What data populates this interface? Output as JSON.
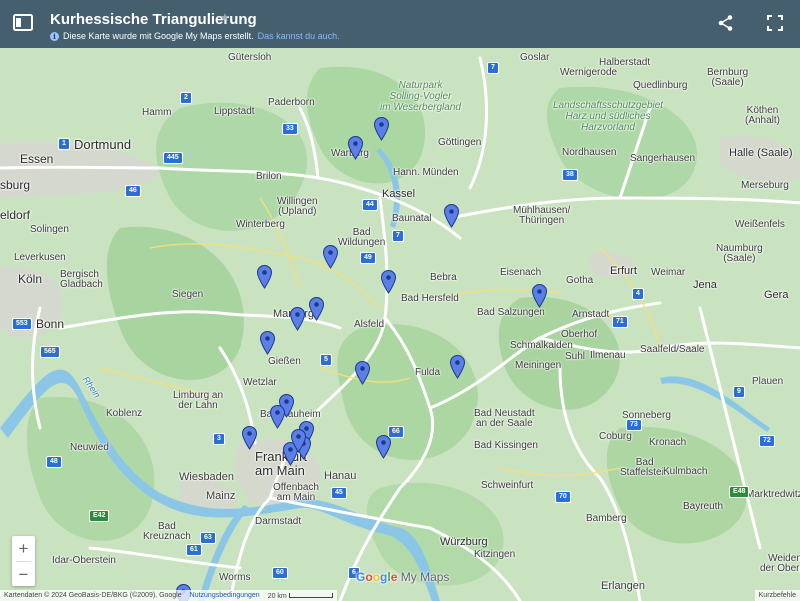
{
  "header": {
    "title": "Kurhessische Triangulierung",
    "subtitle": "Diese Karte wurde mit Google My Maps erstellt.",
    "subtitle_link": "Das kannst du auch.",
    "icons": [
      "sidebar-icon",
      "star-icon",
      "info-icon",
      "share-icon",
      "fullscreen-icon"
    ],
    "colors": {
      "header_bg": "#455f6f",
      "link": "#8ab8ff",
      "marker": "#5b7fe6",
      "map_land": "#c9e3c0"
    }
  },
  "map": {
    "labels": {
      "guetersloh": "Gütersloh",
      "hamm": "Hamm",
      "lippstadt": "Lippstadt",
      "paderborn": "Paderborn",
      "dortmund": "Dortmund",
      "essen": "Essen",
      "burg": "sburg",
      "eldorf": "eldorf",
      "leverkusen": "Leverkusen",
      "solingen": "Solingen",
      "koeln": "Köln",
      "bergisch": "Bergisch\nGladbach",
      "bonn": "Bonn",
      "brilon": "Brilon",
      "willingen": "Willingen\n(Upland)",
      "winterberg": "Winterberg",
      "siegen": "Siegen",
      "warburg": "Warburg",
      "kassel": "Kassel",
      "hann": "Hann. Münden",
      "baunatal": "Baunatal",
      "goettingen": "Göttingen",
      "bad_wildungen": "Bad\nWildungen",
      "marburg": "Marburg",
      "giessen": "Gießen",
      "wetzlar": "Wetzlar",
      "alsfeld": "Alsfeld",
      "bebra": "Bebra",
      "bad_hersfeld": "Bad Hersfeld",
      "fulda": "Fulda",
      "eisenach": "Eisenach",
      "gotha": "Gotha",
      "erfurt": "Erfurt",
      "weimar": "Weimar",
      "jena": "Jena",
      "gera": "Gera",
      "bad_salzungen": "Bad Salzungen",
      "arnstadt": "Arnstadt",
      "oberhof": "Oberhof",
      "schmalkalden": "Schmalkalden",
      "suhl": "Suhl",
      "ilmenau": "Ilmenau",
      "saalfeld": "Saalfeld/Saale",
      "meiningen": "Meiningen",
      "plauen": "Plauen",
      "muehlhausen": "Mühlhausen/\nThüringen",
      "nordhausen": "Nordhausen",
      "sangerhausen": "Sangerhausen",
      "halle": "Halle (Saale)",
      "merseburg": "Merseburg",
      "weissenfels": "Weißenfels",
      "naumburg": "Naumburg\n(Saale)",
      "halberstadt": "Halberstadt",
      "bernburg": "Bernburg\n(Saale)",
      "koethen": "Köthen\n(Anhalt)",
      "goslar": "Goslar",
      "wernigerode": "Wernigerode",
      "quedlinburg": "Quedlinburg",
      "park_solling": "Naturpark\nSolling-Vogler\nim Weserbergland",
      "park_harz": "Landschaftsschutzgebiet\nHarz und südliches\nHarzvorland",
      "koblenz": "Koblenz",
      "limburg": "Limburg an\nder Lahn",
      "bad_nauheim": "Bad Nauheim",
      "frankfurt": "Frankfurt\nam Main",
      "offenbach": "Offenbach\nam Main",
      "hanau": "Hanau",
      "wiesbaden": "Wiesbaden",
      "mainz": "Mainz",
      "darmstadt": "Darmstadt",
      "neuwied": "Neuwied",
      "bad_kreuznach": "Bad\nKreuznach",
      "idar": "Idar-Oberstein",
      "worms": "Worms",
      "bad_neustadt": "Bad Neustadt\nan der Saale",
      "bad_kissingen": "Bad Kissingen",
      "schweinfurt": "Schweinfurt",
      "wuerzburg": "Würzburg",
      "kitzingen": "Kitzingen",
      "bamberg": "Bamberg",
      "erlangen": "Erlangen",
      "coburg": "Coburg",
      "sonneberg": "Sonneberg",
      "kronach": "Kronach",
      "bad_staffelstein": "Bad\nStaffelstein",
      "kulmbach": "Kulmbach",
      "bayreuth": "Bayreuth",
      "marktredwitz": "Marktredwitz",
      "weiden": "Weiden in\nder Oberpfalz",
      "rhein": "Rhein"
    },
    "road_shields": [
      "33",
      "2",
      "1",
      "445",
      "46",
      "44",
      "7",
      "49",
      "5",
      "66",
      "3",
      "45",
      "48",
      "61",
      "60",
      "63",
      "6",
      "565",
      "553",
      "38",
      "71",
      "4",
      "9",
      "73",
      "70",
      "72",
      "7"
    ],
    "euro_shields": [
      "E42",
      "E48"
    ],
    "marker_count": 21,
    "zoom_in": "+",
    "zoom_out": "−",
    "brand_google": "Google",
    "brand_mymaps": "My Maps"
  },
  "footer": {
    "map_data": "Kartendaten © 2024 GeoBasis-DE/BKG (©2009), Google",
    "terms": "Nutzungsbedingungen",
    "scale": "20 km",
    "shortcuts": "Kurzbefehle"
  }
}
